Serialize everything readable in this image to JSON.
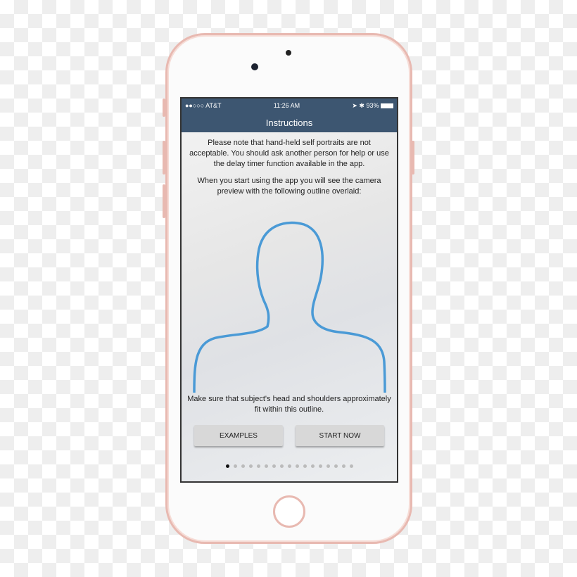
{
  "status": {
    "carrier": "●●○○○ AT&T",
    "time": "11:26 AM",
    "battery": "93%"
  },
  "nav": {
    "title": "Instructions"
  },
  "content": {
    "para1": "Please note that hand-held self portraits are not acceptable. You should ask another person for help or use the delay timer function available in the app.",
    "para2": "When you start using the app you will see the camera preview with the following outline overlaid:",
    "para3": "Make sure that subject's head and shoulders approximately fit within this outline."
  },
  "buttons": {
    "examples": "EXAMPLES",
    "start": "START NOW"
  },
  "pager": {
    "total": 17,
    "current": 1
  },
  "colors": {
    "nav": "#3d5671",
    "outline": "#4a9ad6",
    "phone_trim": "#e8b9b1"
  }
}
